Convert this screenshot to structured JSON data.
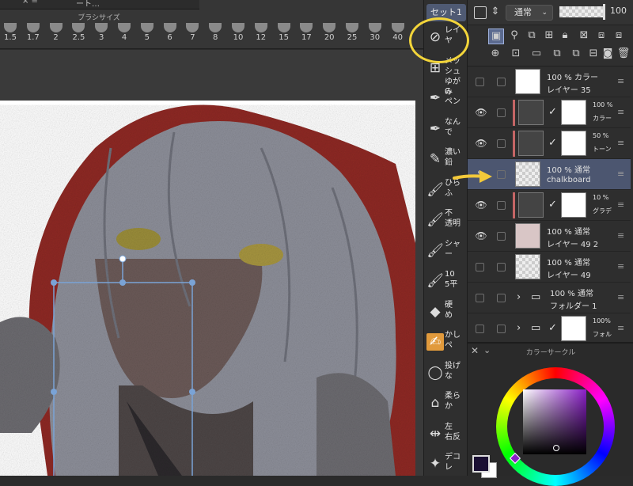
{
  "brush_size_panel": {
    "title": "ブラシサイズ",
    "strip_items": [
      "× =",
      "ート…"
    ],
    "sizes": [
      "1.5",
      "1.7",
      "2",
      "2.5",
      "3",
      "4",
      "5",
      "6",
      "7",
      "8",
      "10",
      "12",
      "15",
      "17",
      "20",
      "25",
      "30",
      "40"
    ]
  },
  "tool_palette": {
    "set_tab": "セット1",
    "items": [
      {
        "icon": "layer-move-icon",
        "label": "レイヤ",
        "active": false
      },
      {
        "icon": "mesh-warp-icon",
        "label": "メッシュ\nゆがみ",
        "active": false
      },
      {
        "icon": "pen-icon",
        "label": "G\nペン",
        "active": false
      },
      {
        "icon": "pen-icon",
        "label": "なん\nで",
        "active": false
      },
      {
        "icon": "pencil-icon",
        "label": "濃い\n鉛",
        "active": false
      },
      {
        "icon": "brush-icon",
        "label": "ひら\nふ",
        "active": false
      },
      {
        "icon": "brush-icon",
        "label": "不\n透明",
        "active": false
      },
      {
        "icon": "brush-icon",
        "label": "シャー",
        "active": false
      },
      {
        "icon": "brush-icon",
        "label": "10\n5平",
        "active": false
      },
      {
        "icon": "eraser-icon",
        "label": "硬\nめ",
        "active": false
      },
      {
        "icon": "blend-icon",
        "label": "かし\nペ",
        "active": true
      },
      {
        "icon": "lasso-icon",
        "label": "投げ\nな",
        "active": false
      },
      {
        "icon": "eraser-soft-icon",
        "label": "柔ら\nか",
        "active": false
      },
      {
        "icon": "flip-icon",
        "label": "左\n右反",
        "active": false
      },
      {
        "icon": "sparkle-icon",
        "label": "デコ\nレ",
        "active": false
      }
    ]
  },
  "layer_panel": {
    "blend_mode": "通常",
    "opacity": "100",
    "layers": [
      {
        "line1": "100 % カラー",
        "line2": "レイヤー 35",
        "eye": false,
        "thumb": "white"
      },
      {
        "line1": "100 %",
        "line2": "カラー",
        "eye": true,
        "thumb": "mask",
        "clipped": true
      },
      {
        "line1": "50 %",
        "line2": "トーン",
        "eye": true,
        "thumb": "mask",
        "clipped": true
      },
      {
        "line1": "100 % 通常",
        "line2": "chalkboard",
        "eye": false,
        "thumb": "checker",
        "selected": true,
        "editing": true
      },
      {
        "line1": "10 %",
        "line2": "グラデ",
        "eye": true,
        "thumb": "mask",
        "clipped": true
      },
      {
        "line1": "100 % 通常",
        "line2": "レイヤー 49 2",
        "eye": true,
        "thumb": "character"
      },
      {
        "line1": "100 % 通常",
        "line2": "レイヤー 49",
        "eye": false,
        "thumb": "checker"
      },
      {
        "line1": "100 % 通常",
        "line2": "フォルダー 1",
        "eye": false,
        "thumb": "folder"
      },
      {
        "line1": "100%",
        "line2": "フォル",
        "eye": false,
        "thumb": "folder-mask"
      }
    ]
  },
  "color_panel": {
    "title": "カラーサークル",
    "main_color": "#1a0f33",
    "sub_color": "#ffffff",
    "hue_color": "#8a1fc7"
  },
  "annotations": {
    "circle_color": "#f3d53a",
    "arrow_color": "#f3c93a"
  }
}
